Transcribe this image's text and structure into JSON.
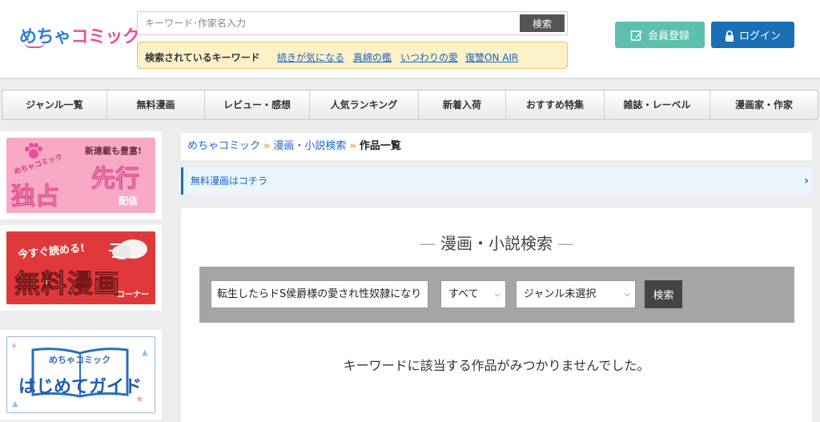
{
  "header": {
    "logo_part1": "めちゃ",
    "logo_part2": "コミック",
    "search_placeholder": "キーワード･作家名入力",
    "search_button": "検索",
    "keywords_title": "検索されているキーワード",
    "keywords": [
      "続きが気になる",
      "真綿の檻",
      "いつわりの愛",
      "復讐ON AIR"
    ],
    "register_button": "会員登録",
    "login_button": "ログイン"
  },
  "nav": {
    "items": [
      "ジャンル一覧",
      "無料漫画",
      "レビュー・感想",
      "人気ランキング",
      "新着入荷",
      "おすすめ特集",
      "雑誌・レーベル",
      "漫画家・作家"
    ]
  },
  "sidebar": {
    "banner1": {
      "brand": "めちゃコミック",
      "tag": "新連載も豊富!",
      "big1": "独占",
      "big2": "先行",
      "sub": "配信"
    },
    "banner2": {
      "small": "今すぐ読める!",
      "big": "無料漫画",
      "corner": "コーナー"
    },
    "banner3": {
      "brand": "めちゃコミック",
      "big": "はじめてガイド"
    }
  },
  "breadcrumb": {
    "items": [
      "めちゃコミック",
      "漫画・小説検索"
    ],
    "current": "作品一覧"
  },
  "free_bar": {
    "text": "無料漫画はコチラ"
  },
  "search_panel": {
    "title": "漫画・小説検索",
    "query": "転生したらドS侯爵様の愛され性奴隷になり",
    "type_select": "すべて",
    "genre_select": "ジャンル未選択",
    "button": "検索",
    "no_result": "キーワードに該当する作品がみつかりませんでした。"
  },
  "colors": {
    "accent_blue": "#1a6fb7",
    "register_green": "#5dbfae",
    "link_blue": "#1a64c8",
    "keyword_bg": "#fdf1c8"
  }
}
